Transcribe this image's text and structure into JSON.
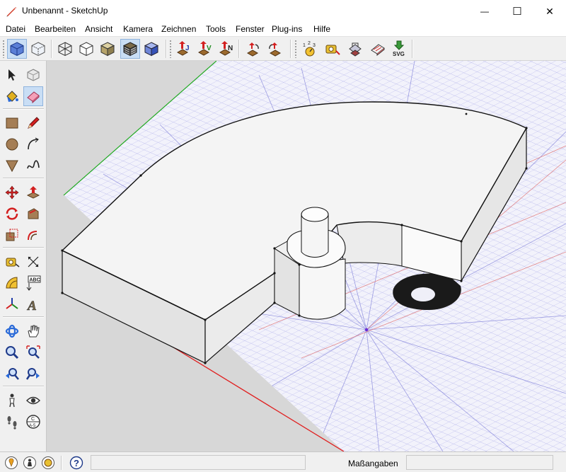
{
  "window": {
    "title": "Unbenannt - SketchUp",
    "minimize_glyph": "—",
    "maximize_glyph": "☐",
    "close_glyph": "✕"
  },
  "menu": {
    "items": [
      "Datei",
      "Bearbeiten",
      "Ansicht",
      "Kamera",
      "Zeichnen",
      "Tools",
      "Fenster",
      "Plug-ins",
      "Hilfe"
    ]
  },
  "toolbar": {
    "buttons": [
      {
        "name": "iso-view",
        "icon": "iso-view-icon"
      },
      {
        "name": "xray",
        "icon": "xray-icon"
      },
      {
        "name": "wireframe",
        "icon": "wireframe-icon"
      },
      {
        "name": "hidden-line",
        "icon": "hidden-line-icon"
      },
      {
        "name": "shaded",
        "icon": "shaded-icon"
      },
      {
        "name": "shaded-with-textures",
        "icon": "shaded-textures-icon"
      },
      {
        "name": "monochrome",
        "icon": "monochrome-icon"
      },
      {
        "name": "export-j",
        "icon": "export-j-icon",
        "letter": "J"
      },
      {
        "name": "export-v",
        "icon": "export-v-icon",
        "letter": "V"
      },
      {
        "name": "export-n",
        "icon": "export-n-icon",
        "letter": "N"
      },
      {
        "name": "rotate-left",
        "icon": "rotate-left-icon"
      },
      {
        "name": "rotate-right",
        "icon": "rotate-right-icon"
      },
      {
        "name": "numbering",
        "icon": "numbering-icon",
        "text": "1 2 3"
      },
      {
        "name": "tape-line",
        "icon": "tape-line-icon"
      },
      {
        "name": "section",
        "icon": "section-icon"
      },
      {
        "name": "eraser-lines",
        "icon": "eraser-lines-icon"
      },
      {
        "name": "export-svg",
        "icon": "export-svg-icon",
        "text": "SVG"
      }
    ]
  },
  "left_tools": [
    {
      "name": "select",
      "icon": "select-arrow-icon"
    },
    {
      "name": "make-component",
      "icon": "component-icon"
    },
    {
      "name": "paint-bucket",
      "icon": "paint-bucket-icon"
    },
    {
      "name": "eraser",
      "icon": "eraser-icon"
    },
    {
      "name": "rectangle",
      "icon": "rectangle-icon"
    },
    {
      "name": "line",
      "icon": "pencil-icon"
    },
    {
      "name": "circle",
      "icon": "circle-icon"
    },
    {
      "name": "arc",
      "icon": "arc-icon"
    },
    {
      "name": "polygon",
      "icon": "polygon-icon"
    },
    {
      "name": "freehand",
      "icon": "freehand-icon"
    },
    {
      "name": "move",
      "icon": "move-icon"
    },
    {
      "name": "push-pull",
      "icon": "push-pull-icon"
    },
    {
      "name": "rotate",
      "icon": "rotate-icon"
    },
    {
      "name": "follow-me",
      "icon": "follow-me-icon"
    },
    {
      "name": "scale",
      "icon": "scale-icon"
    },
    {
      "name": "offset",
      "icon": "offset-icon"
    },
    {
      "name": "tape-measure",
      "icon": "tape-measure-icon"
    },
    {
      "name": "dimension",
      "icon": "dimension-icon"
    },
    {
      "name": "protractor",
      "icon": "protractor-icon"
    },
    {
      "name": "text",
      "icon": "text-label-icon",
      "text": "ABC"
    },
    {
      "name": "axes",
      "icon": "axes-icon"
    },
    {
      "name": "3d-text",
      "icon": "3d-text-icon",
      "text": "A"
    },
    {
      "name": "orbit",
      "icon": "orbit-icon"
    },
    {
      "name": "pan",
      "icon": "hand-icon"
    },
    {
      "name": "zoom",
      "icon": "zoom-icon"
    },
    {
      "name": "zoom-extents",
      "icon": "zoom-extents-icon"
    },
    {
      "name": "previous-view",
      "icon": "previous-view-icon"
    },
    {
      "name": "next-view",
      "icon": "next-view-icon"
    },
    {
      "name": "position-camera",
      "icon": "position-camera-icon"
    },
    {
      "name": "look-around",
      "icon": "eye-icon"
    },
    {
      "name": "walk",
      "icon": "footprints-icon"
    },
    {
      "name": "section-plane",
      "icon": "section-plane-icon",
      "text": "C\nA-5"
    }
  ],
  "statusbar": {
    "icons": [
      "geo-location-icon",
      "credits-icon",
      "signin-icon",
      "help-icon"
    ],
    "hint": "",
    "measurements_label": "Maßangaben",
    "measurements_value": ""
  },
  "colors": {
    "red_axis": "#e02020",
    "green_axis": "#22aa22",
    "blue_axis": "#3b3bdc",
    "grid": "#b7b7ec",
    "viewport_bg": "#d7d7d7",
    "model_top": "#f4f4f4",
    "model_side": "#e4e4e4",
    "shadow": "#1a1a1a"
  }
}
